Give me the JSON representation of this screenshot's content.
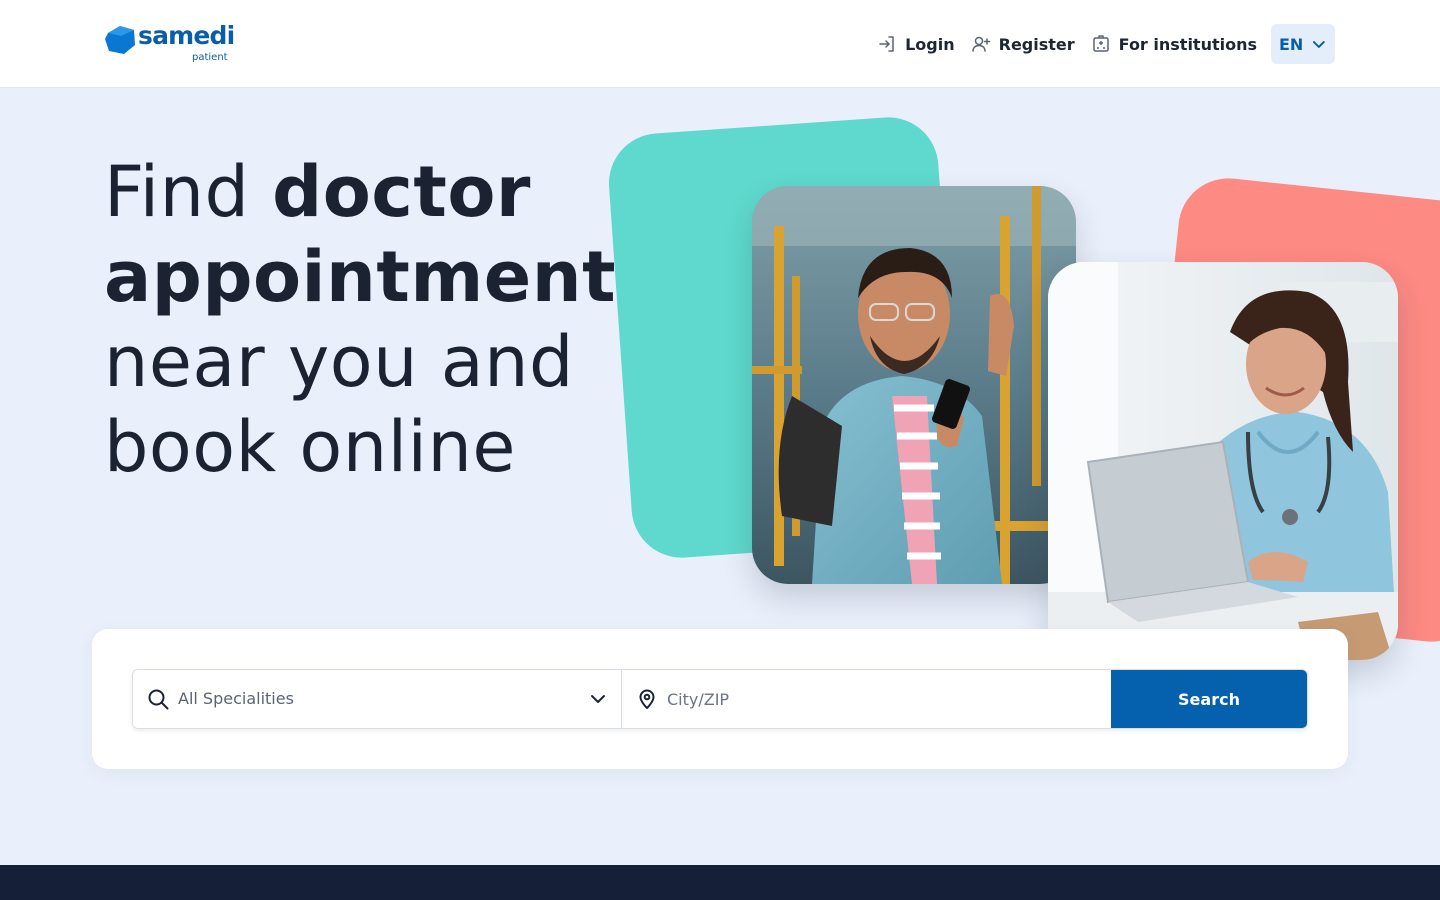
{
  "brand": {
    "name": "samedi",
    "sub": "patient",
    "color": "#0a5ea8"
  },
  "nav": {
    "login": {
      "label": "Login",
      "icon": "login-icon"
    },
    "register": {
      "label": "Register",
      "icon": "user-plus-icon"
    },
    "institutions": {
      "label": "For institutions",
      "icon": "building-icon"
    },
    "language": {
      "value": "EN",
      "icon": "chevron-down-icon"
    }
  },
  "hero": {
    "line1_normal": "Find ",
    "line1_bold": "doctor appointments",
    "line2_normal": " near you and book online"
  },
  "search": {
    "specialities_placeholder": "All Specialities",
    "city_placeholder": "City/ZIP",
    "button_label": "Search"
  },
  "colors": {
    "background": "#e9f0fb",
    "teal_shape": "#5fd9cd",
    "coral_shape": "#fd8a83",
    "primary": "#0560ad",
    "footer": "#151f38"
  }
}
